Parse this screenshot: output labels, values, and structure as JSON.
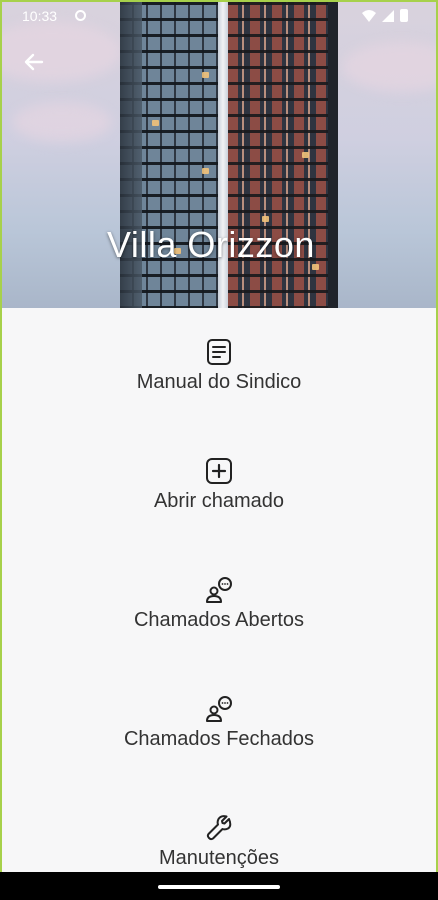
{
  "status_bar": {
    "time": "10:33"
  },
  "header": {
    "title": "Villa Orizzon"
  },
  "menu": {
    "items": [
      {
        "label": "Manual do Sindico",
        "icon": "document-icon"
      },
      {
        "label": "Abrir chamado",
        "icon": "plus-square-icon"
      },
      {
        "label": "Chamados Abertos",
        "icon": "user-chat-icon"
      },
      {
        "label": "Chamados Fechados",
        "icon": "user-chat-icon"
      },
      {
        "label": "Manutenções",
        "icon": "wrench-icon"
      }
    ]
  },
  "colors": {
    "frame_border": "#a7d14b",
    "background": "#f7f7f8",
    "text": "#333333"
  }
}
